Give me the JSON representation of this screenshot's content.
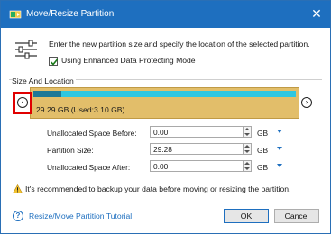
{
  "window": {
    "title": "Move/Resize Partition",
    "close_glyph": "✕"
  },
  "intro": {
    "description": "Enter the new partition size and specify the location of the selected partition.",
    "checkbox_label": "Using Enhanced Data Protecting Mode",
    "checkbox_checked": true
  },
  "size_location": {
    "group_label": "Size And Location",
    "partition_text": "29.29 GB (Used:3.10 GB)",
    "used_fraction": 0.106,
    "left_arrow_glyph": "‹",
    "right_arrow_glyph": "›"
  },
  "fields": [
    {
      "label": "Unallocated Space Before:",
      "value": "0.00",
      "unit": "GB"
    },
    {
      "label": "Partition Size:",
      "value": "29.28",
      "unit": "GB"
    },
    {
      "label": "Unallocated Space After:",
      "value": "0.00",
      "unit": "GB"
    }
  ],
  "warning": {
    "text": "It's recommended to backup your data before moving or resizing the partition."
  },
  "footer": {
    "help_glyph": "?",
    "help_link": "Resize/Move Partition Tutorial",
    "ok_label": "OK",
    "cancel_label": "Cancel"
  },
  "colors": {
    "titlebar": "#1e6fbf",
    "partition_fill": "#e2be6a",
    "bar_free": "#2fc7e0",
    "bar_used": "#1d7896",
    "highlight": "#e00000"
  }
}
